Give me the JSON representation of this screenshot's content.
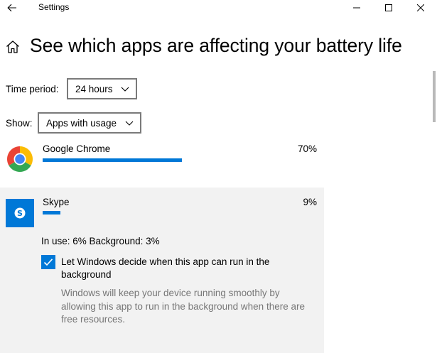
{
  "window": {
    "title": "Settings",
    "back_icon": "back-arrow-icon",
    "minimize_icon": "minimize-icon",
    "maximize_icon": "maximize-icon",
    "close_icon": "close-icon"
  },
  "header": {
    "home_icon": "home-icon",
    "title": "See which apps are affecting your battery life"
  },
  "filters": {
    "time_period": {
      "label": "Time period:",
      "selected": "24 hours"
    },
    "show": {
      "label": "Show:",
      "selected": "Apps with usage"
    }
  },
  "apps": [
    {
      "name": "Google Chrome",
      "percent": "70%",
      "usage_fraction": 0.7,
      "icon": "chrome-icon"
    },
    {
      "name": "Skype",
      "percent": "9%",
      "usage_fraction": 0.09,
      "icon": "skype-icon",
      "expanded": true,
      "detail": "In use: 6% Background: 3%",
      "checkbox": {
        "checked": true,
        "label": "Let Windows decide when this app can run in the background",
        "description": "Windows will keep your device running smoothly by allowing this app to run in the background when there are free resources."
      }
    }
  ],
  "colors": {
    "accent": "#0078d7",
    "selected_row_bg": "#f2f2f2",
    "secondary_text": "#767676"
  }
}
